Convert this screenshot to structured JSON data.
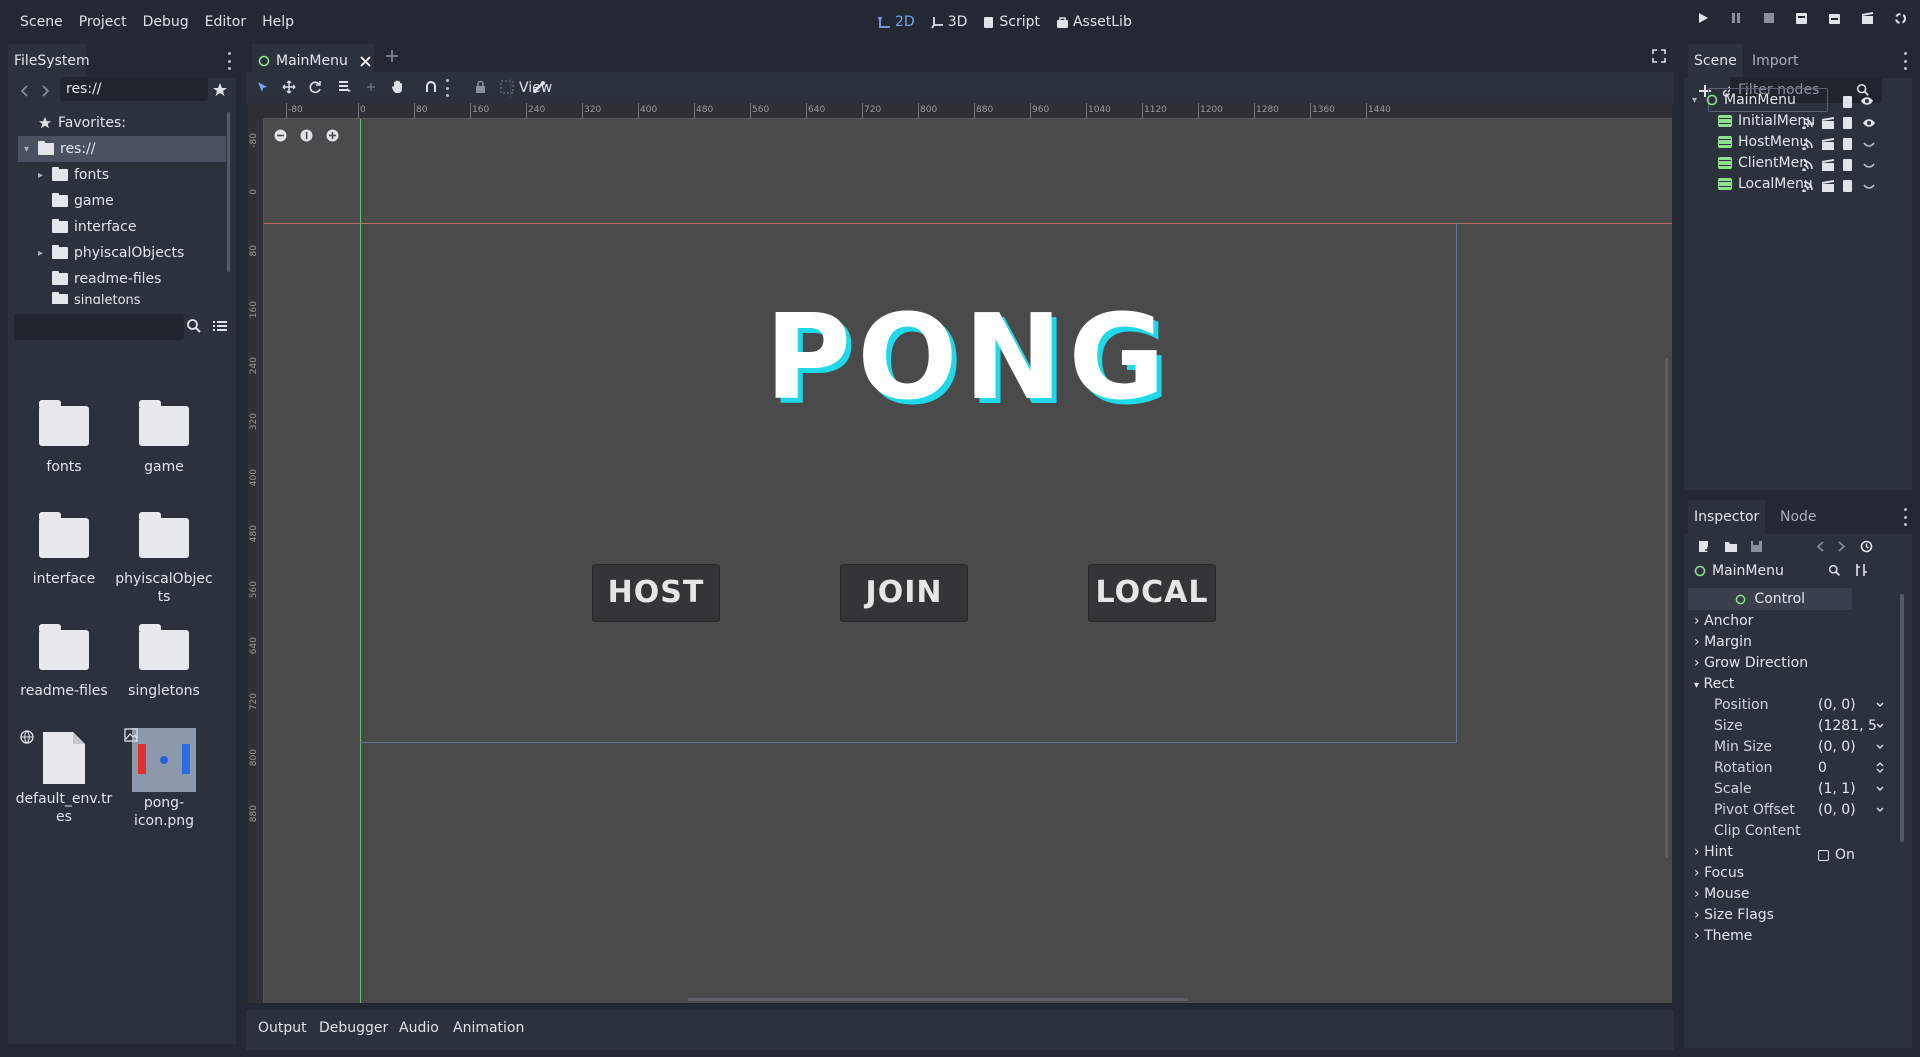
{
  "menu": [
    "Scene",
    "Project",
    "Debug",
    "Editor",
    "Help"
  ],
  "modes": [
    {
      "label": "2D",
      "icon": "2d-icon",
      "active": true
    },
    {
      "label": "3D",
      "icon": "3d-icon",
      "active": false
    },
    {
      "label": "Script",
      "icon": "script-icon",
      "active": false
    },
    {
      "label": "AssetLib",
      "icon": "assetlib-icon",
      "active": false
    }
  ],
  "accent": "#76a6f0",
  "filesystem": {
    "title": "FileSystem",
    "path": "res://",
    "tree": [
      {
        "label": "Favorites:",
        "icon": "star-icon"
      },
      {
        "label": "res://",
        "icon": "folder-icon",
        "selected": true
      },
      {
        "label": "fonts",
        "icon": "folder-icon",
        "expandable": true
      },
      {
        "label": "game",
        "icon": "folder-icon"
      },
      {
        "label": "interface",
        "icon": "folder-icon"
      },
      {
        "label": "phyiscalObjects",
        "icon": "folder-icon",
        "expandable": true
      },
      {
        "label": "readme-files",
        "icon": "folder-icon"
      },
      {
        "label": "singletons",
        "icon": "folder-icon"
      }
    ],
    "grid": [
      {
        "label": "fonts",
        "type": "folder"
      },
      {
        "label": "game",
        "type": "folder"
      },
      {
        "label": "interface",
        "type": "folder"
      },
      {
        "label": "phyiscalObjects",
        "type": "folder"
      },
      {
        "label": "readme-files",
        "type": "folder"
      },
      {
        "label": "singletons",
        "type": "folder"
      },
      {
        "label": "default_env.tres",
        "type": "file"
      },
      {
        "label": "pong-icon.png",
        "type": "image"
      }
    ]
  },
  "editor": {
    "tab": "MainMenu",
    "view_menu": "View",
    "canvas": {
      "title": "PONG",
      "title_color": "#ffffff",
      "title_shadow": "#1fd8e8",
      "buttons": [
        "HOST",
        "JOIN",
        "LOCAL"
      ]
    },
    "ruler_top": [
      "-80",
      "0",
      "80",
      "160",
      "240",
      "320",
      "400",
      "480",
      "560",
      "640",
      "720",
      "800",
      "880",
      "960",
      "1040",
      "1120",
      "1200",
      "1280",
      "1360",
      "1440"
    ],
    "ruler_left": [
      "-80",
      "0",
      "80",
      "160",
      "240",
      "320",
      "400",
      "480",
      "560",
      "640",
      "720",
      "800",
      "880"
    ]
  },
  "bottom_tabs": [
    "Output",
    "Debugger",
    "Audio",
    "Animation"
  ],
  "scene": {
    "tabs": [
      "Scene",
      "Import"
    ],
    "filter_placeholder": "Filter nodes",
    "root": "MainMenu",
    "children": [
      "InitialMenu",
      "HostMenu",
      "ClientMen",
      "LocalMenu"
    ]
  },
  "inspector": {
    "tabs": [
      "Inspector",
      "Node"
    ],
    "node": "MainMenu",
    "class": "Control",
    "sections_before": [
      "Anchor",
      "Margin",
      "Grow Direction"
    ],
    "rect": "Rect",
    "props": [
      {
        "name": "Position",
        "value": "(0, 0)"
      },
      {
        "name": "Size",
        "value": "(1281, 5"
      },
      {
        "name": "Min Size",
        "value": "(0, 0)"
      },
      {
        "name": "Rotation",
        "value": "0"
      },
      {
        "name": "Scale",
        "value": "(1, 1)"
      },
      {
        "name": "Pivot Offset",
        "value": "(0, 0)"
      },
      {
        "name": "Clip Content",
        "value": "On"
      }
    ],
    "sections_after": [
      "Hint",
      "Focus",
      "Mouse",
      "Size Flags",
      "Theme"
    ]
  }
}
